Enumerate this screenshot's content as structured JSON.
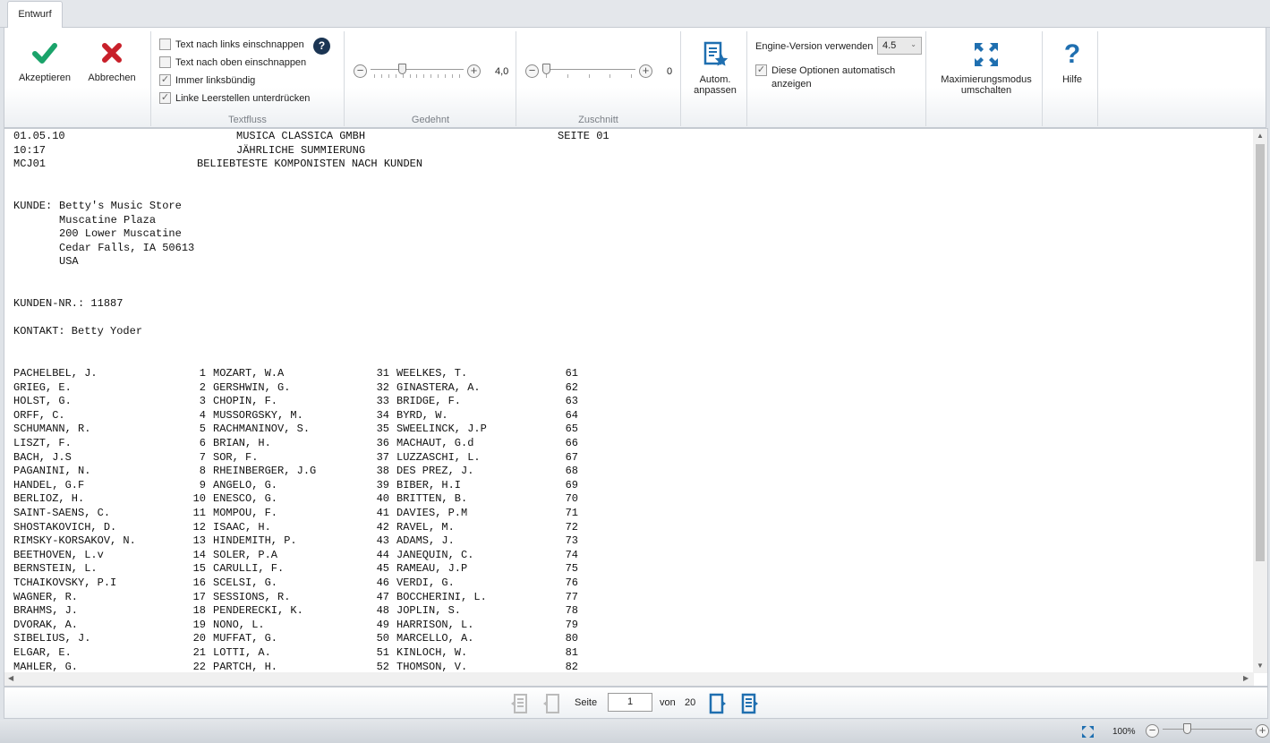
{
  "tab": "Entwurf",
  "ribbon": {
    "accept": "Akzeptieren",
    "cancel": "Abbrechen",
    "textflow": {
      "label": "Textfluss",
      "options": [
        {
          "label": "Text nach links einschnappen",
          "checked": false
        },
        {
          "label": "Text nach oben einschnappen",
          "checked": false
        },
        {
          "label": "Immer linksbündig",
          "checked": true
        },
        {
          "label": "Linke Leerstellen unterdrücken",
          "checked": true
        }
      ]
    },
    "stretch": {
      "label": "Gedehnt",
      "value": "4,0",
      "level": 0.33
    },
    "crop": {
      "label": "Zuschnitt",
      "value": "0",
      "level": 0
    },
    "auto_fit": "Autom. anpassen",
    "engine_label": "Engine-Version verwenden",
    "engine_value": "4.5",
    "auto_show": {
      "label": "Diese Optionen automatisch anzeigen",
      "checked": true
    },
    "maximize": "Maximierungsmodus umschalten",
    "help": "Hilfe"
  },
  "report": {
    "header": [
      [
        "01.05.10",
        "MUSICA CLASSICA GMBH",
        "SEITE 01"
      ],
      [
        "10:17",
        "JÄHRLICHE SUMMIERUNG",
        ""
      ],
      [
        "MCJ01",
        "BELIEBTESTE KOMPONISTEN NACH KUNDEN",
        ""
      ]
    ],
    "customer_label": "KUNDE:",
    "customer": [
      "Betty's Music Store",
      "Muscatine Plaza",
      "200 Lower Muscatine",
      "Cedar Falls, IA 50613",
      "USA"
    ],
    "customer_no": "KUNDEN-NR.: 11887",
    "contact": "KONTAKT: Betty Yoder",
    "rows": [
      [
        "PACHELBEL, J.",
        "1",
        "MOZART, W.A",
        "31",
        "WEELKES, T.",
        "61"
      ],
      [
        "GRIEG, E.",
        "2",
        "GERSHWIN, G.",
        "32",
        "GINASTERA, A.",
        "62"
      ],
      [
        "HOLST, G.",
        "3",
        "CHOPIN, F.",
        "33",
        "BRIDGE, F.",
        "63"
      ],
      [
        "ORFF, C.",
        "4",
        "MUSSORGSKY, M.",
        "34",
        "BYRD, W.",
        "64"
      ],
      [
        "SCHUMANN, R.",
        "5",
        "RACHMANINOV, S.",
        "35",
        "SWEELINCK, J.P",
        "65"
      ],
      [
        "LISZT, F.",
        "6",
        "BRIAN, H.",
        "36",
        "MACHAUT, G.d",
        "66"
      ],
      [
        "BACH, J.S",
        "7",
        "SOR, F.",
        "37",
        "LUZZASCHI, L.",
        "67"
      ],
      [
        "PAGANINI, N.",
        "8",
        "RHEINBERGER, J.G",
        "38",
        "DES PREZ, J.",
        "68"
      ],
      [
        "HANDEL, G.F",
        "9",
        "ANGELO, G.",
        "39",
        "BIBER, H.I",
        "69"
      ],
      [
        "BERLIOZ, H.",
        "10",
        "ENESCO, G.",
        "40",
        "BRITTEN, B.",
        "70"
      ],
      [
        "SAINT-SAENS, C.",
        "11",
        "MOMPOU, F.",
        "41",
        "DAVIES, P.M",
        "71"
      ],
      [
        "SHOSTAKOVICH, D.",
        "12",
        "ISAAC, H.",
        "42",
        "RAVEL, M.",
        "72"
      ],
      [
        "RIMSKY-KORSAKOV, N.",
        "13",
        "HINDEMITH, P.",
        "43",
        "ADAMS, J.",
        "73"
      ],
      [
        "BEETHOVEN, L.v",
        "14",
        "SOLER, P.A",
        "44",
        "JANEQUIN, C.",
        "74"
      ],
      [
        "BERNSTEIN, L.",
        "15",
        "CARULLI, F.",
        "45",
        "RAMEAU, J.P",
        "75"
      ],
      [
        "TCHAIKOVSKY, P.I",
        "16",
        "SCELSI, G.",
        "46",
        "VERDI, G.",
        "76"
      ],
      [
        "WAGNER, R.",
        "17",
        "SESSIONS, R.",
        "47",
        "BOCCHERINI, L.",
        "77"
      ],
      [
        "BRAHMS, J.",
        "18",
        "PENDERECKI, K.",
        "48",
        "JOPLIN, S.",
        "78"
      ],
      [
        "DVORAK, A.",
        "19",
        "NONO, L.",
        "49",
        "HARRISON, L.",
        "79"
      ],
      [
        "SIBELIUS, J.",
        "20",
        "MUFFAT, G.",
        "50",
        "MARCELLO, A.",
        "80"
      ],
      [
        "ELGAR, E.",
        "21",
        "LOTTI, A.",
        "51",
        "KINLOCH, W.",
        "81"
      ],
      [
        "MAHLER, G.",
        "22",
        "PARTCH, H.",
        "52",
        "THOMSON, V.",
        "82"
      ]
    ]
  },
  "nav": {
    "page_label": "Seite",
    "page": "1",
    "of_label": "von",
    "total": "20"
  },
  "status": {
    "zoom": "100%",
    "zoom_level": 0.25
  },
  "colors": {
    "accept": "#1aa36a",
    "cancel": "#c8202a",
    "accent": "#1f6fb0",
    "help_badge": "#1b3553"
  }
}
